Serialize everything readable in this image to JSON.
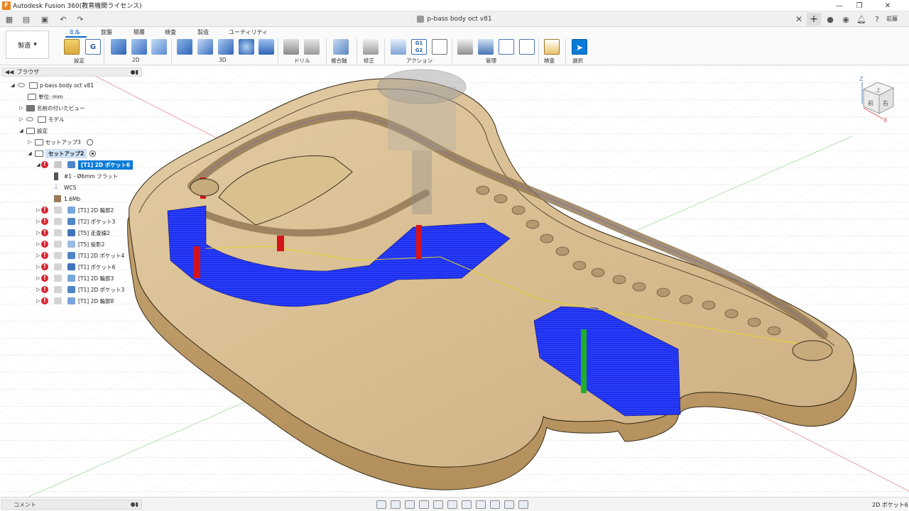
{
  "window": {
    "title": "Autodesk Fusion 360(教育機関ライセンス)",
    "app_icon": "F",
    "doc_title": "p-bass body oct v81",
    "user": "岩藤"
  },
  "ribbon": {
    "workspace": "製造",
    "tabs": [
      "ミル",
      "旋盤",
      "積層",
      "検査",
      "製造",
      "ユーティリティ"
    ],
    "groups": [
      "設定",
      "2D",
      "3D",
      "ドリル",
      "複合軸",
      "修正",
      "アクション",
      "管理",
      "検査",
      "選択"
    ]
  },
  "browser": {
    "title": "ブラウザ",
    "items": [
      {
        "label": "p-bass body oct v81"
      },
      {
        "label": "単位: mm"
      },
      {
        "label": "名前の付いたビュー"
      },
      {
        "label": "モデル"
      },
      {
        "label": "設定"
      },
      {
        "label": "セットアップ3"
      },
      {
        "label": "セットアップ2"
      },
      {
        "label": "[T1] 2D ポケット6"
      },
      {
        "label": "#1 - Ø6mm フラット"
      },
      {
        "label": "WCS"
      },
      {
        "label": "1.6Mb"
      },
      {
        "label": "[T1] 2D 輪郭2"
      },
      {
        "label": "[T2] ポケット3"
      },
      {
        "label": "[T5] 走査線2"
      },
      {
        "label": "[T5] 投影2"
      },
      {
        "label": "[T1] 2D ポケット4"
      },
      {
        "label": "[T1] ポケット6"
      },
      {
        "label": "[T1] 2D 輪郭3"
      },
      {
        "label": "[T1] 2D ポケット3"
      },
      {
        "label": "[T1] 2D 輪郭8"
      }
    ]
  },
  "viewcube": {
    "top": "上",
    "front": "前",
    "right": "右",
    "axis_x": "X",
    "axis_z": "Z"
  },
  "status": {
    "comment_label": "コメント",
    "selection": "2D ポケット6"
  },
  "colors": {
    "accent": "#0a7bd8",
    "error": "#d9232e",
    "wood": "#d9bf92",
    "toolpath": "#1c2fe0"
  }
}
